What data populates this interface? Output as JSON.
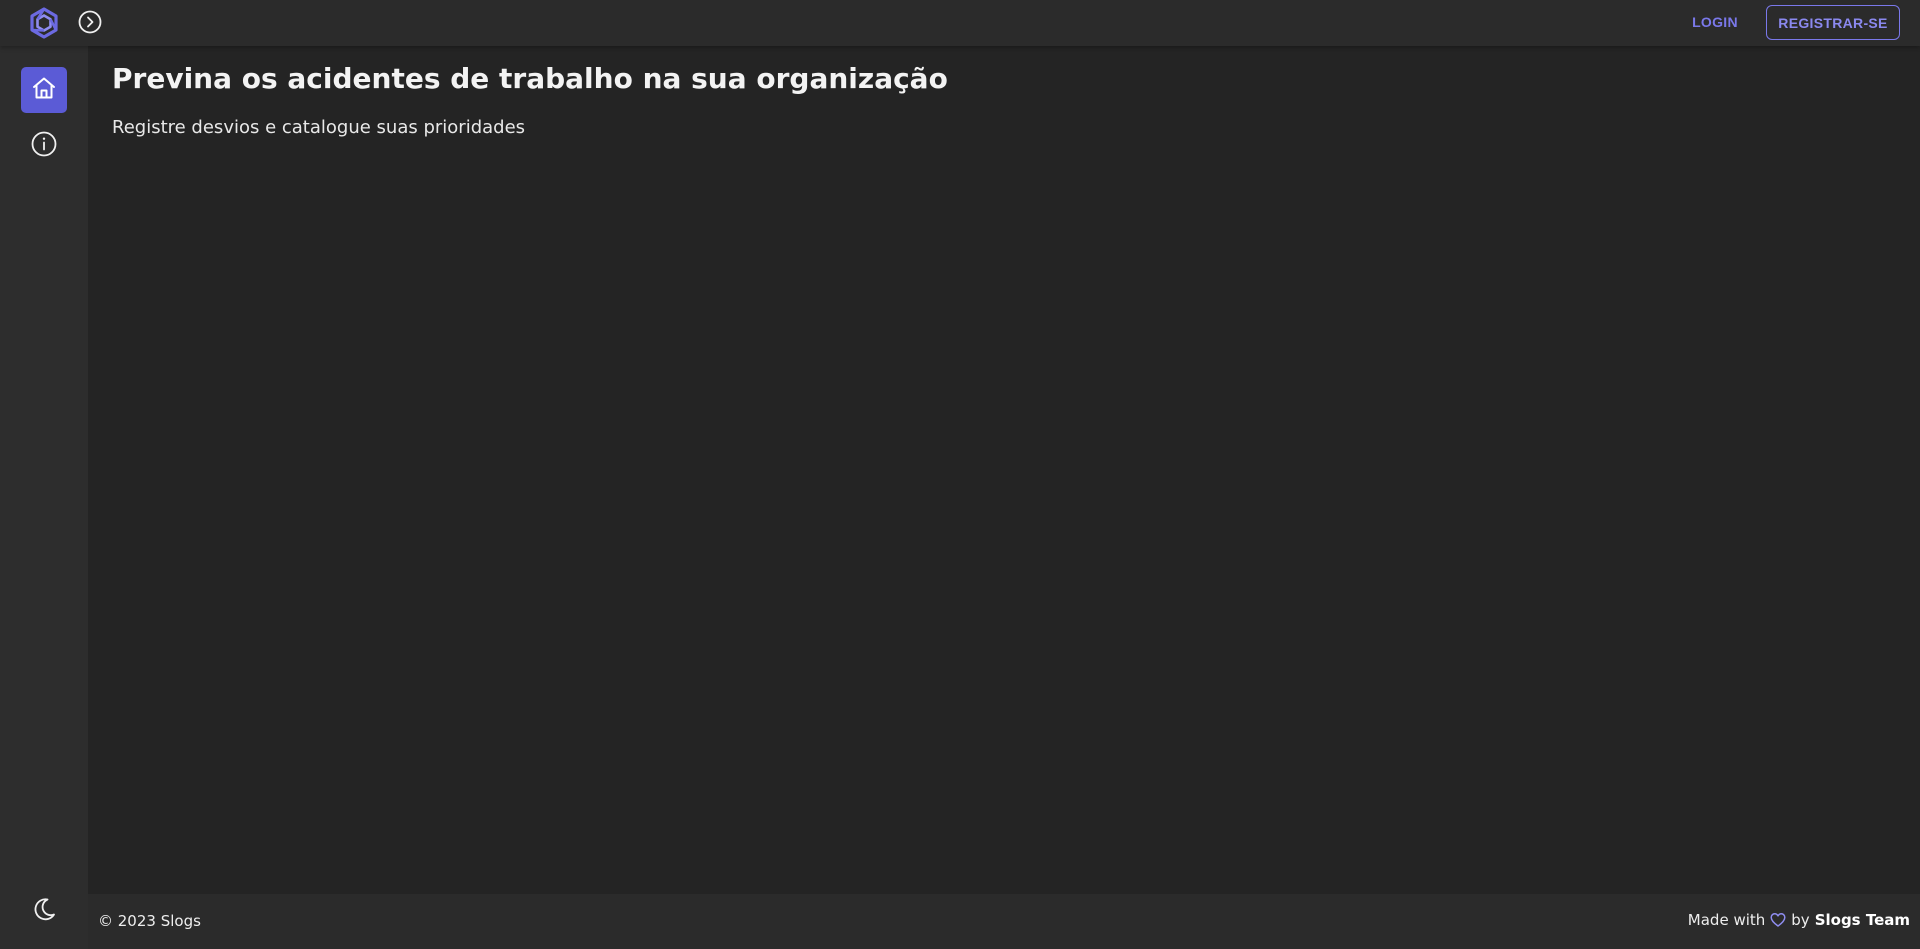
{
  "topbar": {
    "logo_icon": "slogs-hexagon-logo",
    "expand_icon": "chevron-right-circle-icon",
    "login_label": "LOGIN",
    "register_label": "REGISTRAR-SE",
    "accent_color": "#7a78ea"
  },
  "sidebar": {
    "items": [
      {
        "icon": "home-icon",
        "active": true
      },
      {
        "icon": "info-icon",
        "active": false
      }
    ],
    "theme_toggle_icon": "moon-icon",
    "active_color": "#5b5bd6"
  },
  "main": {
    "title": "Previna os acidentes de trabalho na sua organização",
    "subtitle": "Registre desvios e catalogue suas prioridades"
  },
  "footer": {
    "copyright": "© 2023 Slogs",
    "made_with_prefix": "Made with",
    "made_with_by": "by",
    "team_name": "Slogs Team",
    "heart_icon": "heart-icon"
  }
}
